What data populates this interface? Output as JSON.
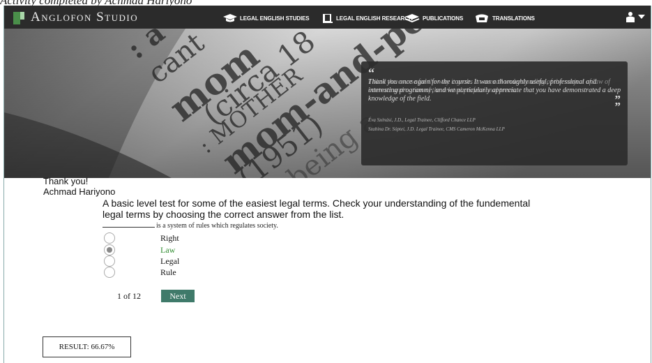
{
  "caption": "Activity completed by Achmad Hariyono",
  "header": {
    "brand": "Anglofon Studio",
    "nav": [
      {
        "label": "LEGAL ENGLISH STUDIES",
        "icon": "graduation-cap-icon"
      },
      {
        "label": "LEGAL ENGLISH RESEARCH",
        "icon": "book-icon"
      },
      {
        "label": "PUBLICATIONS",
        "icon": "stack-icon"
      },
      {
        "label": "TRANSLATIONS",
        "icon": "folder-icon"
      }
    ],
    "user_icon": "user-icon"
  },
  "hero": {
    "dictionary_words": [
      "mom",
      "cant",
      ": a",
      "(circa 18",
      ": MOTHER",
      "mom-and-po",
      "(1951)",
      "being a"
    ],
    "quote": {
      "text": "Thank you once again for the course. It was a thoroughly useful, professional and interesting programme, and we particularly appreciate that you have demonstrated a deep knowledge of the field.",
      "overlay": "I liked the course for the way it grabs an overall understanding of the subject of law of contract and notion of the related professional terms.",
      "author1": "Éva Szénási, J.D., Legal Trainee, Clifford Chance LLP",
      "author2": "Szabina Dr. Sóptei, J.D. Legal Trainee, CMS Cameron McKenna LLP"
    }
  },
  "content": {
    "thanks": "Thank you!",
    "name": "Achmad Hariyono",
    "description": "A basic level test for some of the easiest legal terms. Check your understanding of the fundemental legal terms by choosing the correct answer from the list.",
    "question": "is a system of rules which regulates society.",
    "options": [
      {
        "label": "Right",
        "selected": false
      },
      {
        "label": "Law",
        "selected": true
      },
      {
        "label": "Legal",
        "selected": false
      },
      {
        "label": "Rule",
        "selected": false
      }
    ],
    "counter": "1 of 12",
    "next": "Next",
    "result": "RESULT: 66.67%"
  }
}
